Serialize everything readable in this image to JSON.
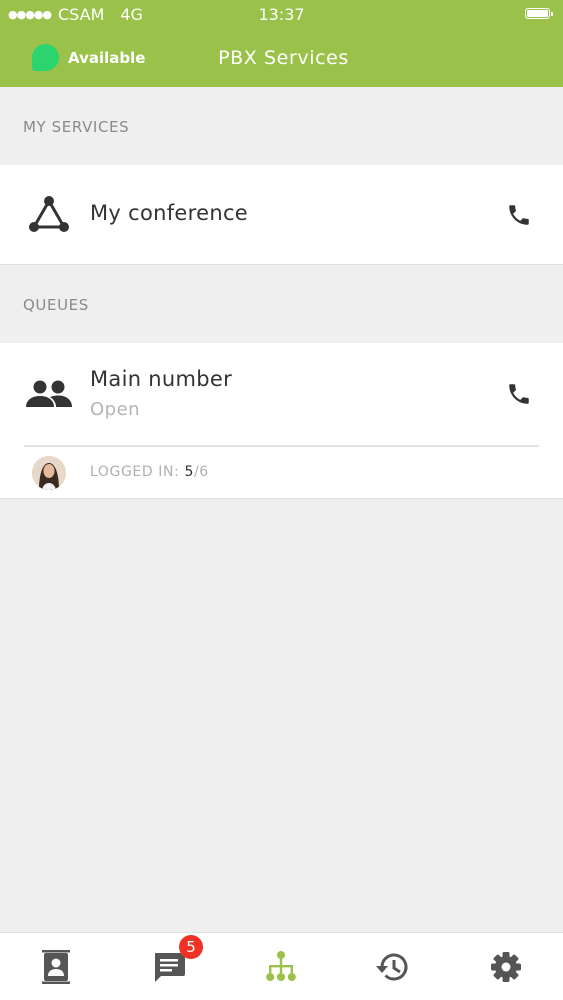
{
  "status_bar": {
    "signal_dots": "●●●●●",
    "carrier": "CSAM",
    "network": "4G",
    "time": "13:37"
  },
  "header": {
    "presence_label": "Available",
    "title": "PBX Services"
  },
  "my_services": {
    "section_label": "MY SERVICES",
    "items": [
      {
        "label": "My conference"
      }
    ]
  },
  "queues": {
    "section_label": "QUEUES",
    "items": [
      {
        "name": "Main number",
        "status": "Open",
        "logged_label": "LOGGED IN: ",
        "logged_count": "5",
        "logged_total": "/6"
      }
    ]
  },
  "tab_bar": {
    "tabs": [
      "contacts-icon",
      "messages-icon",
      "pbx-services-icon",
      "history-icon",
      "settings-icon"
    ],
    "messages_badge": "5"
  },
  "colors": {
    "header": "#9ac24a",
    "presence_available": "#2bd46f",
    "active_tab": "#9ac24a",
    "badge": "#ee3324"
  }
}
